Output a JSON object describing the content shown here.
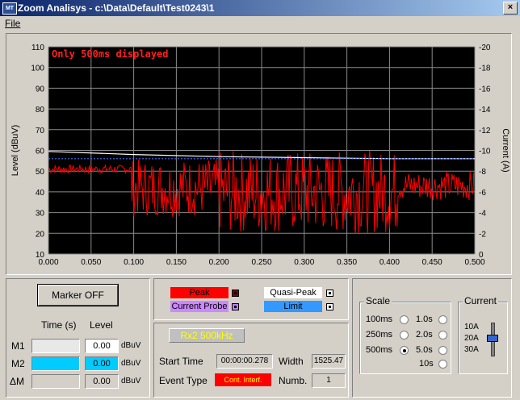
{
  "window": {
    "title": "Zoom Analisys - c:\\Data\\Default\\Test0243\\1",
    "icon_text": "MT",
    "close_label": "×"
  },
  "menu": {
    "file": "File"
  },
  "chart_data": {
    "type": "line",
    "annotation": "Only 500ms displayed",
    "xlabel": "",
    "ylabel_left": "Level (dBuV)",
    "ylabel_right": "Current (A)",
    "xlim": [
      0,
      0.5
    ],
    "ylim_left": [
      10,
      110
    ],
    "ylim_right": [
      0,
      -20
    ],
    "x_ticks": [
      "0.000",
      "0.050",
      "0.100",
      "0.150",
      "0.200",
      "0.250",
      "0.300",
      "0.350",
      "0.400",
      "0.450",
      "0.500"
    ],
    "y_ticks_left": [
      "110",
      "100",
      "90",
      "80",
      "70",
      "60",
      "50",
      "40",
      "30",
      "20",
      "10"
    ],
    "y_ticks_right": [
      "-20",
      "-18",
      "-16",
      "-14",
      "-12",
      "-10",
      "-8",
      "-6",
      "-4",
      "-2",
      "0"
    ],
    "grid": true,
    "background": "#000000",
    "series": [
      {
        "name": "Peak",
        "color": "#ff0000",
        "segments": [
          {
            "x0": 0.0,
            "x1": 0.098,
            "base": 51,
            "amp": 2
          },
          {
            "x0": 0.098,
            "x1": 0.2,
            "base": 42,
            "amp": 14
          },
          {
            "x0": 0.2,
            "x1": 0.41,
            "base": 40,
            "amp": 20
          },
          {
            "x0": 0.41,
            "x1": 0.5,
            "base": 43,
            "amp": 7
          }
        ]
      },
      {
        "name": "Quasi-Peak",
        "color": "#ffffff",
        "points": [
          [
            0.0,
            59.5
          ],
          [
            0.1,
            58
          ],
          [
            0.2,
            57
          ],
          [
            0.3,
            56.5
          ],
          [
            0.4,
            56
          ],
          [
            0.5,
            56
          ]
        ]
      },
      {
        "name": "Limit",
        "color": "#3a6bff",
        "points": [
          [
            0.0,
            56
          ],
          [
            0.5,
            56
          ]
        ]
      }
    ]
  },
  "marker": {
    "button": "Marker OFF",
    "time_header": "Time (s)",
    "level_header": "Level",
    "rows": [
      {
        "label": "M1",
        "time": "",
        "level": "0.00",
        "unit": "dBuV"
      },
      {
        "label": "M2",
        "time": "",
        "level": "0.00",
        "unit": "dBuV"
      },
      {
        "label": "ΔM",
        "time": "",
        "level": "0.00",
        "unit": "dBuV"
      }
    ],
    "highlight": "#00ccff"
  },
  "legend": {
    "peak": "Peak",
    "current_probe": "Current Probe",
    "quasi_peak": "Quasi-Peak",
    "limit": "Limit",
    "colors": {
      "peak": "#ff0000",
      "current_probe": "#cc88ff",
      "quasi_peak": "#ffffff",
      "limit": "#3399ff"
    }
  },
  "info": {
    "receiver": "Rx2 500kHz",
    "start_time_label": "Start Time",
    "start_time": "00:00:00.278",
    "width_label": "Width",
    "width": "1525.47",
    "event_type_label": "Event Type",
    "event_type": "Cont. Interf.",
    "numb_label": "Numb.",
    "numb": "1"
  },
  "scale": {
    "title": "Scale",
    "options": [
      "100ms",
      "250ms",
      "500ms",
      "1.0s",
      "2.0s",
      "5.0s",
      "10s"
    ],
    "selected": "500ms"
  },
  "current": {
    "title": "Current",
    "options": [
      "10A",
      "20A",
      "30A"
    ],
    "selected": "20A"
  }
}
